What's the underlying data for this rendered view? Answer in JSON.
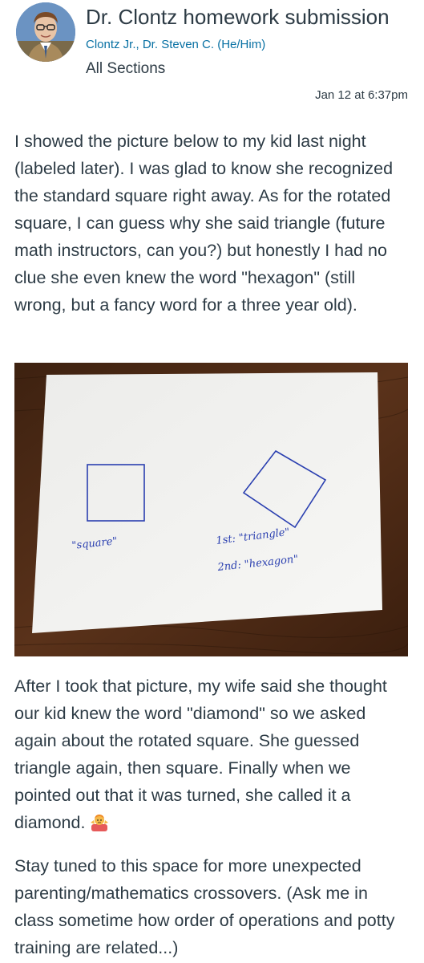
{
  "header": {
    "title": "Dr. Clontz homework submission",
    "author": "Clontz Jr., Dr. Steven C. (He/Him)",
    "sections": "All Sections",
    "date": "Jan 12 at 6:37pm",
    "avatar_icon": "profile-photo"
  },
  "post": {
    "paragraph1": "I showed the picture below to my kid last night (labeled later). I was glad to know she recognized the standard square right away. As for the rotated square, I can guess why she said triangle (future math instructors, can you?) but honestly I had no clue she even knew the word \"hexagon\" (still wrong, but a fancy word for a three year old).",
    "photo": {
      "label_square": "\"square\"",
      "label_first": "1st: \"triangle\"",
      "label_second": "2nd: \"hexagon\""
    },
    "paragraph2": "After I took that picture, my wife said she thought our kid knew the word \"diamond\" so we asked again about the rotated square. She guessed triangle again, then square. Finally when we pointed out that it was turned, she called it a diamond.",
    "emoji_icon": "person-shrugging-emoji",
    "paragraph3": "Stay tuned to this space for more unexpected parenting/mathematics crossovers. (Ask me in class sometime how order of operations and potty training are related...)"
  },
  "colors": {
    "text": "#2d3b45",
    "link": "#0770a3",
    "ink": "#2a3fb0",
    "wood": "#4a2a16",
    "paper": "#f3f3f1"
  }
}
